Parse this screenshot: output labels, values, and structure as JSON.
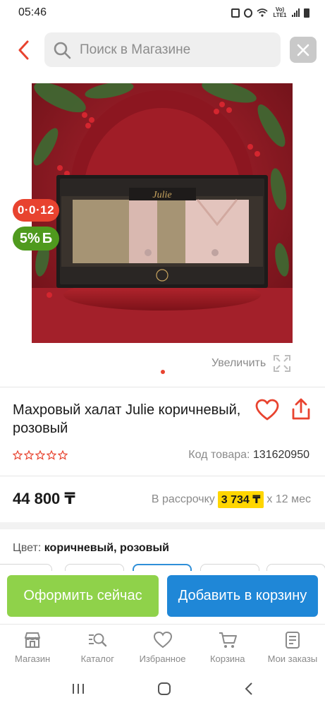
{
  "status_bar": {
    "time": "05:46",
    "network": "Vo) LTE1"
  },
  "search": {
    "placeholder": "Поиск в Магазине"
  },
  "product": {
    "badges": {
      "installment": "0·0·12",
      "bonus_percent": "5%",
      "bonus_symbol": "Б"
    },
    "zoom_label": "Увеличить",
    "title": "Махровый халат Julie коричневый, розовый",
    "rating_stars": 5,
    "code_label": "Код товара:",
    "code_value": "131620950",
    "price": "44 800 ₸",
    "installment_prefix": "В рассрочку",
    "installment_amount": "3 734 ₸",
    "installment_suffix": "х 12 мес",
    "color_label": "Цвет:",
    "color_value": "коричневый, розовый",
    "image_brand": "Julie"
  },
  "actions": {
    "checkout": "Оформить сейчас",
    "add_to_cart": "Добавить в корзину"
  },
  "bottom_nav": [
    {
      "label": "Магазин",
      "icon": "shop-icon"
    },
    {
      "label": "Каталог",
      "icon": "catalog-search-icon"
    },
    {
      "label": "Избранное",
      "icon": "heart-icon"
    },
    {
      "label": "Корзина",
      "icon": "cart-icon"
    },
    {
      "label": "Мои заказы",
      "icon": "orders-icon"
    }
  ],
  "colors": {
    "accent_red": "#e8432f",
    "green": "#8fd24a",
    "blue": "#1f87d7",
    "bonus_green": "#4f9a1e",
    "highlight_yellow": "#ffd600"
  }
}
